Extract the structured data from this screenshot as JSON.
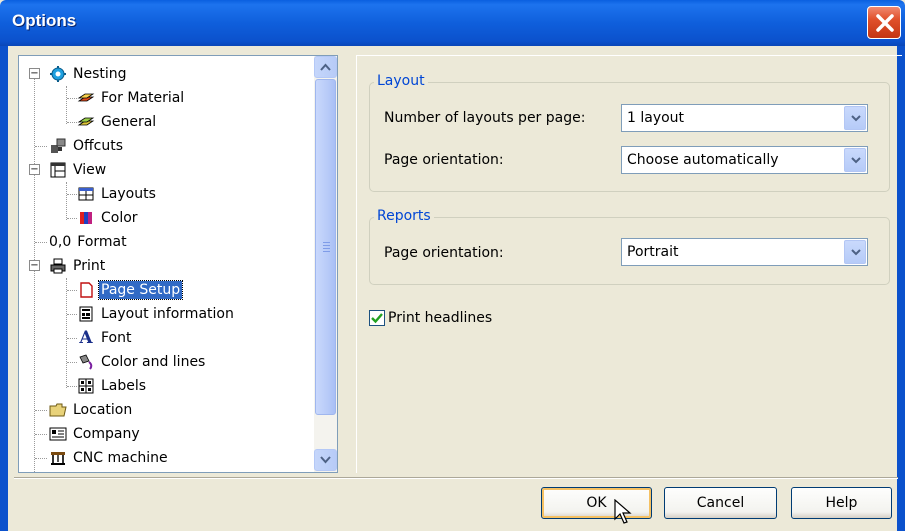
{
  "window": {
    "title": "Options"
  },
  "tree": {
    "items": [
      {
        "label": "Nesting",
        "icon": "gear-icon",
        "level": 0,
        "expanded": true
      },
      {
        "label": "For Material",
        "icon": "material-stack-icon",
        "level": 1
      },
      {
        "label": "General",
        "icon": "material-stack-icon",
        "level": 1
      },
      {
        "label": "Offcuts",
        "icon": "offcuts-icon",
        "level": 0
      },
      {
        "label": "View",
        "icon": "window-icon",
        "level": 0,
        "expanded": true
      },
      {
        "label": "Layouts",
        "icon": "layouts-icon",
        "level": 1
      },
      {
        "label": "Color",
        "icon": "color-bars-icon",
        "level": 1
      },
      {
        "label": "Format",
        "prefix": "0,0",
        "icon": "format-icon",
        "level": 0
      },
      {
        "label": "Print",
        "icon": "printer-icon",
        "level": 0,
        "expanded": true
      },
      {
        "label": "Page Setup",
        "icon": "page-icon",
        "level": 1,
        "selected": true
      },
      {
        "label": "Layout information",
        "icon": "layout-info-icon",
        "level": 1
      },
      {
        "label": "Font",
        "icon": "font-icon",
        "level": 1
      },
      {
        "label": "Color and lines",
        "icon": "paint-icon",
        "level": 1
      },
      {
        "label": "Labels",
        "icon": "labels-icon",
        "level": 1
      },
      {
        "label": "Location",
        "icon": "folder-icon",
        "level": 0
      },
      {
        "label": "Company",
        "icon": "company-card-icon",
        "level": 0
      },
      {
        "label": "CNC machine",
        "icon": "cnc-machine-icon",
        "level": 0
      }
    ]
  },
  "layout_group": {
    "title": "Layout",
    "layouts_per_page_label": "Number of layouts per page:",
    "layouts_per_page_value": "1 layout",
    "page_orientation_label": "Page orientation:",
    "page_orientation_value": "Choose automatically"
  },
  "reports_group": {
    "title": "Reports",
    "page_orientation_label": "Page orientation:",
    "page_orientation_value": "Portrait"
  },
  "print_headlines": {
    "label": "Print headlines",
    "checked": true
  },
  "buttons": {
    "ok": "OK",
    "cancel": "Cancel",
    "help": "Help"
  },
  "colors": {
    "title_bar": "#0b51cc",
    "selection": "#316ac5",
    "group_title": "#0046d5"
  }
}
